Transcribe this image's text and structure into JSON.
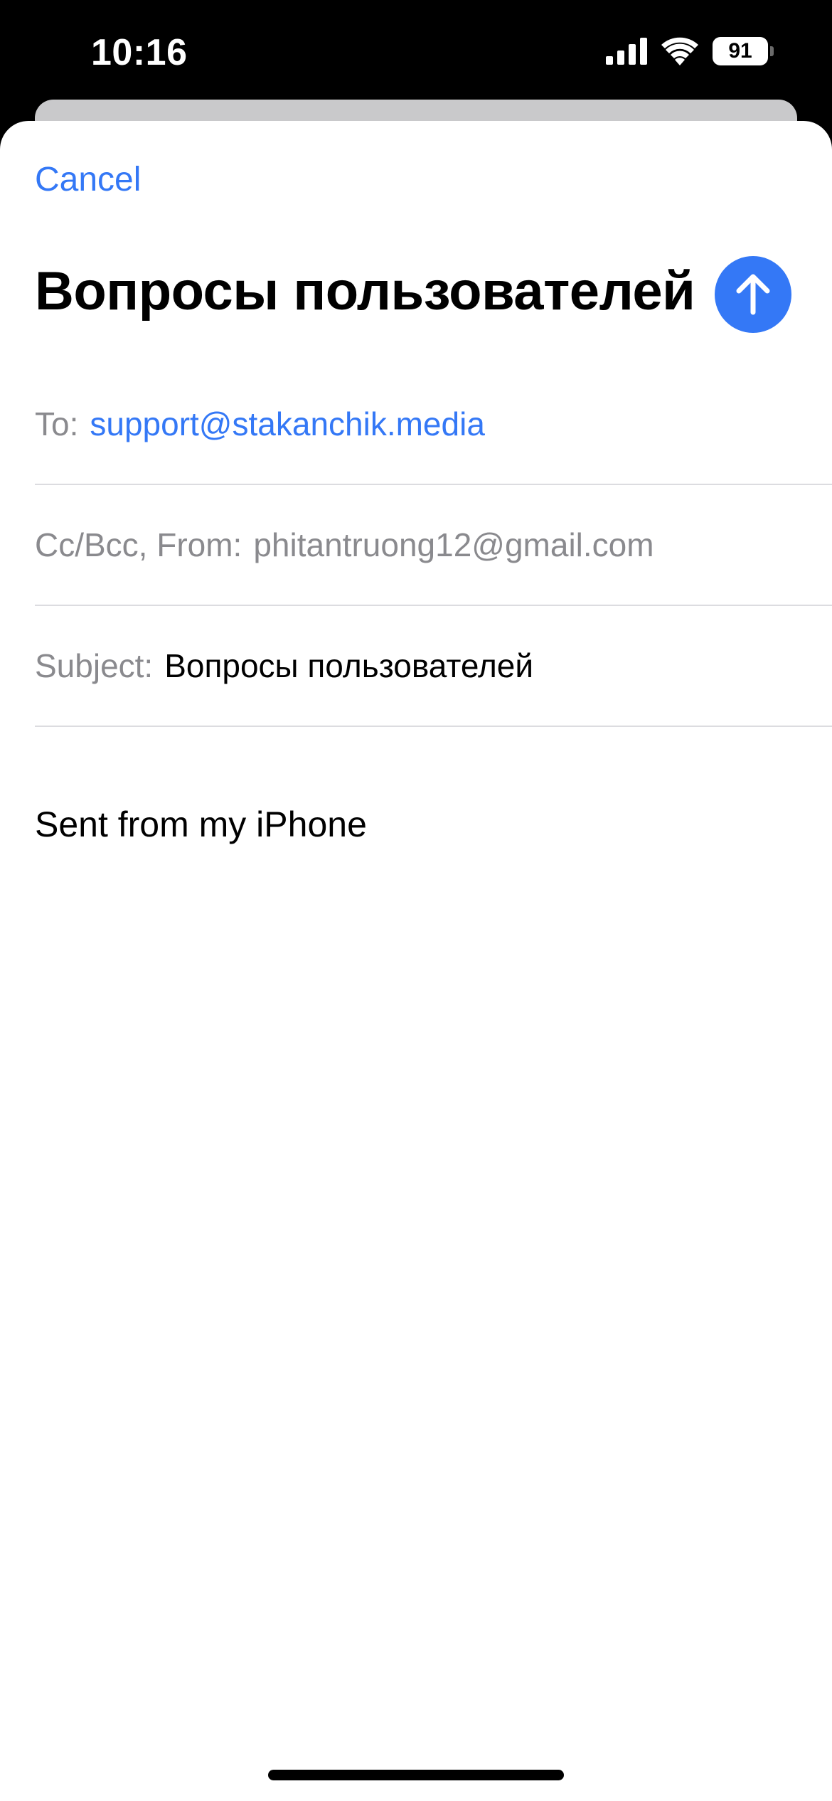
{
  "status_bar": {
    "time": "10:16",
    "battery_level": "91",
    "icons": [
      "signal-icon",
      "wifi-icon",
      "battery-icon"
    ]
  },
  "compose": {
    "cancel_label": "Cancel",
    "title": "Вопросы пользователей",
    "send_icon": "arrow-up-icon",
    "to_label": "To:",
    "to_value": "support@stakanchik.media",
    "ccbcc_label": "Cc/Bcc, From:",
    "from_value": "phitantruong12@gmail.com",
    "subject_label": "Subject:",
    "subject_value": "Вопросы пользователей",
    "body": "Sent from my iPhone"
  },
  "colors": {
    "accent": "#3478f6",
    "label_gray": "#8a8a8e",
    "divider": "#dcdce0"
  }
}
